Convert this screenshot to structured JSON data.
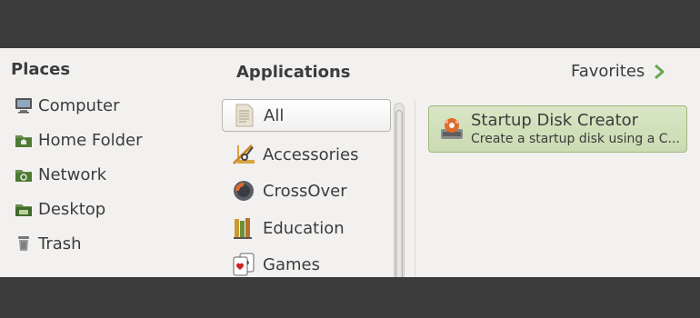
{
  "places": {
    "title": "Places",
    "items": [
      {
        "label": "Computer",
        "icon": "computer-icon"
      },
      {
        "label": "Home Folder",
        "icon": "home-folder-icon"
      },
      {
        "label": "Network",
        "icon": "network-folder-icon"
      },
      {
        "label": "Desktop",
        "icon": "desktop-folder-icon"
      },
      {
        "label": "Trash",
        "icon": "trash-icon"
      }
    ]
  },
  "applications": {
    "title": "Applications",
    "categories": [
      {
        "label": "All",
        "icon": "all-document-icon",
        "selected": true
      },
      {
        "label": "Accessories",
        "icon": "accessories-icon"
      },
      {
        "label": "CrossOver",
        "icon": "crossover-icon"
      },
      {
        "label": "Education",
        "icon": "education-icon"
      },
      {
        "label": "Games",
        "icon": "games-cards-icon"
      }
    ]
  },
  "favorites": {
    "label": "Favorites",
    "icon": "chevron-right-icon"
  },
  "app_results": [
    {
      "name": "Startup Disk Creator",
      "description": "Create a startup disk using a C...",
      "icon": "startup-disk-creator-icon"
    }
  ],
  "colors": {
    "tile_bg": "#d2e1bc",
    "tile_border": "#9fb87f",
    "chevron": "#6aa84f"
  }
}
